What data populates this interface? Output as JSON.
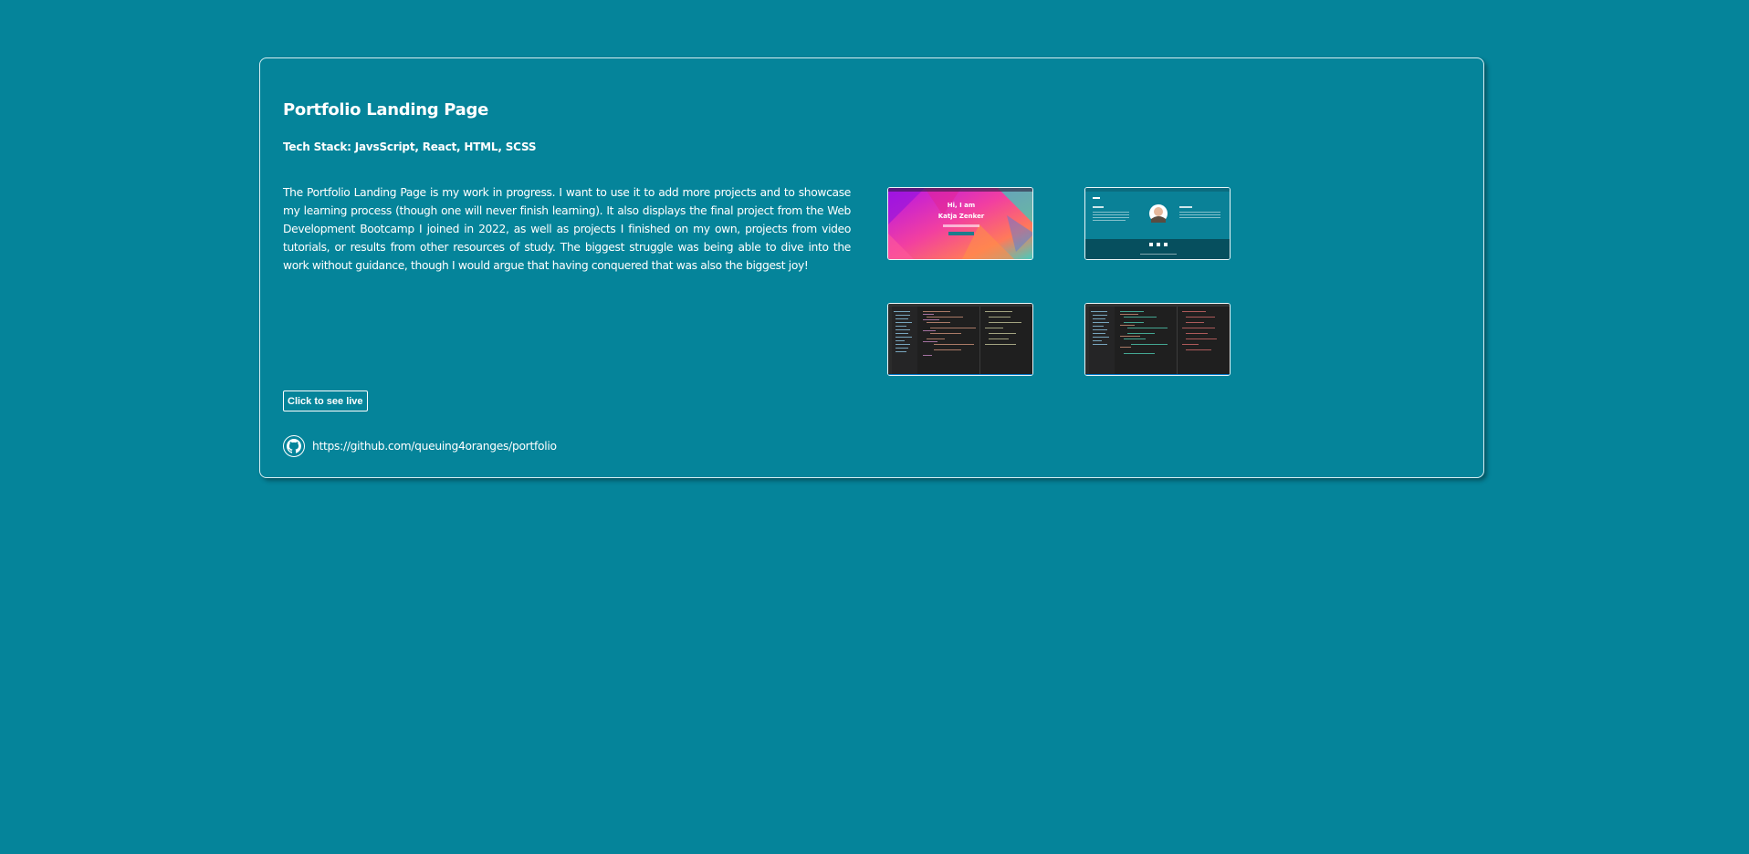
{
  "project": {
    "title": "Portfolio Landing Page",
    "tech_stack": "Tech Stack: JavsScript, React, HTML, SCSS",
    "description": "The Portfolio Landing Page is my work in progress. I want to use it to add more projects and to showcase my learning process (though one will never finish learning). It also displays the final project from the Web Development Bootcamp I joined in 2022, as well as projects I finished on my own, projects from video tutorials, or results from other resources of study. The biggest struggle was being able to dive into the work without guidance, though I would argue that having conquered that was also the biggest joy!",
    "live_button": "Click to see live",
    "github_url": "https://github.com/queuing4oranges/portfolio"
  },
  "thumbnails": {
    "hero_greeting": "Hi, I am",
    "hero_name": "Katja Zenker"
  },
  "icons": {
    "github": "github-icon"
  },
  "colors": {
    "background": "#05849a",
    "border": "#d7eef2",
    "text": "#ffffff"
  }
}
